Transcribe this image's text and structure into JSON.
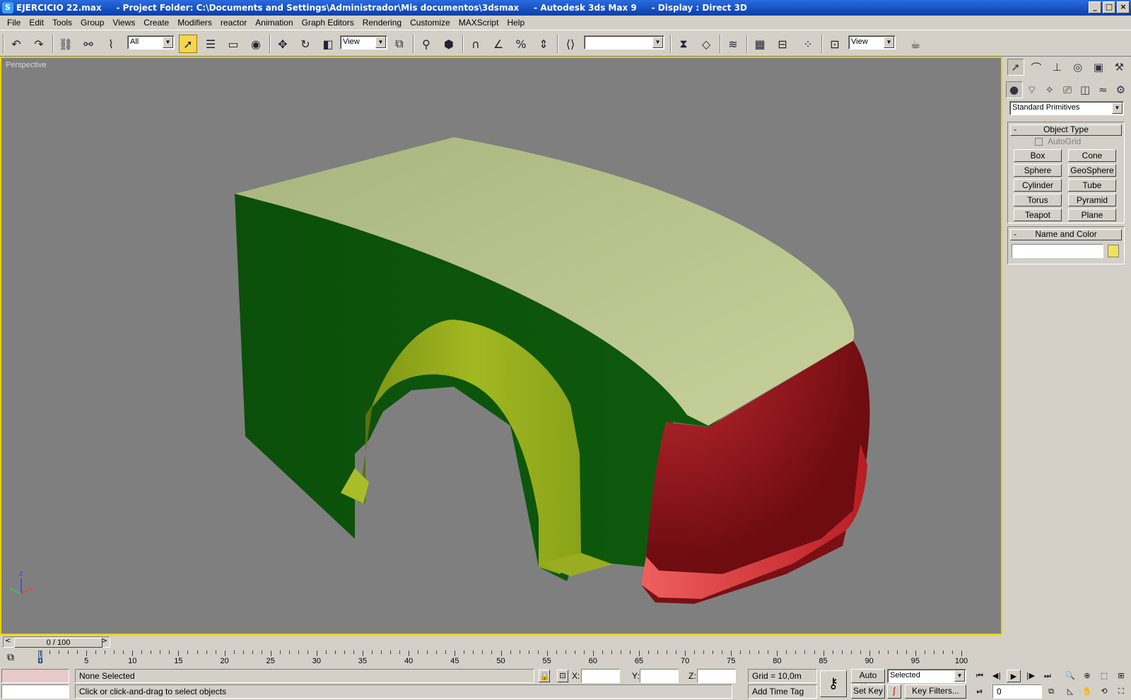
{
  "window": {
    "title": "EJERCICIO 22.max     - Project Folder: C:\\Documents and Settings\\Administrador\\Mis documentos\\3dsmax     - Autodesk 3ds Max 9     - Display : Direct 3D",
    "minimize": "_",
    "maximize": "□",
    "close": "×"
  },
  "menu": [
    "File",
    "Edit",
    "Tools",
    "Group",
    "Views",
    "Create",
    "Modifiers",
    "reactor",
    "Animation",
    "Graph Editors",
    "Rendering",
    "Customize",
    "MAXScript",
    "Help"
  ],
  "toolbar": {
    "selection_filter": "All",
    "ref_coord_system": "View",
    "named_selection": "",
    "render_view": "View"
  },
  "viewport": {
    "label": "Perspective",
    "axis_x": "x",
    "axis_z": "z",
    "colors": {
      "border_active": "#e6d300",
      "background": "#7f7f7f",
      "top": "#c3cc93",
      "side": "#0e5a0b",
      "arch": "#9bb31e",
      "bumper": "#a81a1c"
    }
  },
  "command_panel": {
    "category": "Standard Primitives",
    "object_type": {
      "title": "Object Type",
      "autogrid": "AutoGrid",
      "buttons": [
        "Box",
        "Cone",
        "Sphere",
        "GeoSphere",
        "Cylinder",
        "Tube",
        "Torus",
        "Pyramid",
        "Teapot",
        "Plane"
      ]
    },
    "name_color": {
      "title": "Name and Color",
      "name_value": "",
      "swatch_color": "#f2e25a"
    }
  },
  "time_slider": {
    "label": "0 / 100",
    "prev": "<",
    "next": ">",
    "value": 0,
    "max": 100
  },
  "track_bar": {
    "labels": [
      "0",
      "5",
      "10",
      "15",
      "20",
      "25",
      "30",
      "35",
      "40",
      "45",
      "50",
      "55",
      "60",
      "65",
      "70",
      "75",
      "80",
      "85",
      "90",
      "95",
      "100"
    ]
  },
  "status": {
    "selection": "None Selected",
    "prompt": "Click or click-and-drag to select objects",
    "x_label": "X:",
    "y_label": "Y:",
    "z_label": "Z:",
    "x_value": "",
    "y_value": "",
    "z_value": "",
    "grid": "Grid = 10,0m",
    "add_time_tag": "Add Time Tag",
    "auto_key": "Auto Key",
    "set_key": "Set Key",
    "key_mode": "Selected",
    "key_filters": "Key Filters...",
    "frame": "0"
  }
}
